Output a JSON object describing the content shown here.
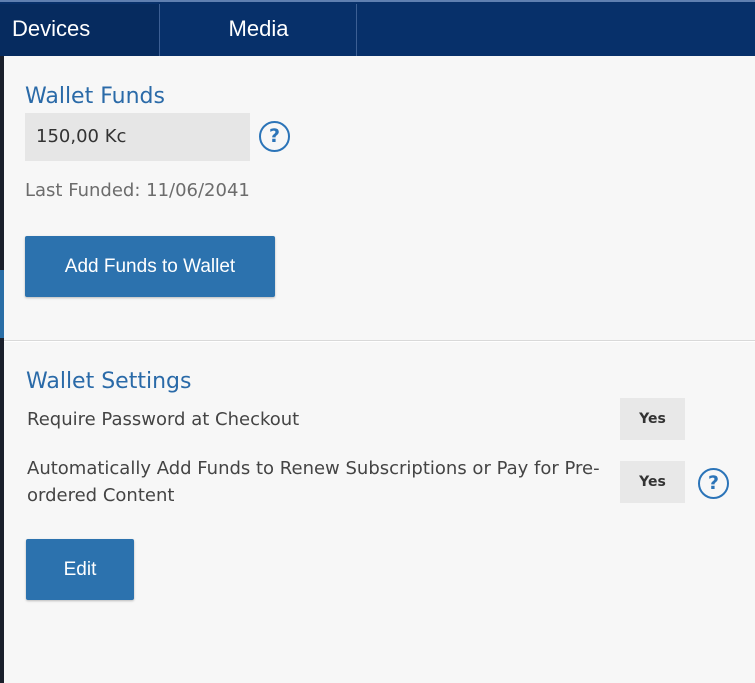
{
  "nav": {
    "tabs": [
      {
        "label": "Devices"
      },
      {
        "label": "Media"
      }
    ]
  },
  "wallet": {
    "title": "Wallet Funds",
    "balance": "150,00 Kc",
    "last_funded": "Last Funded: 11/06/2041",
    "add_funds_label": "Add Funds to Wallet",
    "help_icon": "question-mark-icon"
  },
  "settings": {
    "title": "Wallet Settings",
    "items": [
      {
        "label": "Require Password at Checkout",
        "value": "Yes"
      },
      {
        "label": "Automatically Add Funds to Renew Subscriptions or Pay for Pre-ordered Content",
        "value": "Yes",
        "icon": "question-mark-icon"
      }
    ],
    "edit_label": "Edit"
  },
  "colors": {
    "nav_bg": "#07306a",
    "accent_blue": "#2c72ae",
    "title_blue": "#2a6aa8"
  }
}
